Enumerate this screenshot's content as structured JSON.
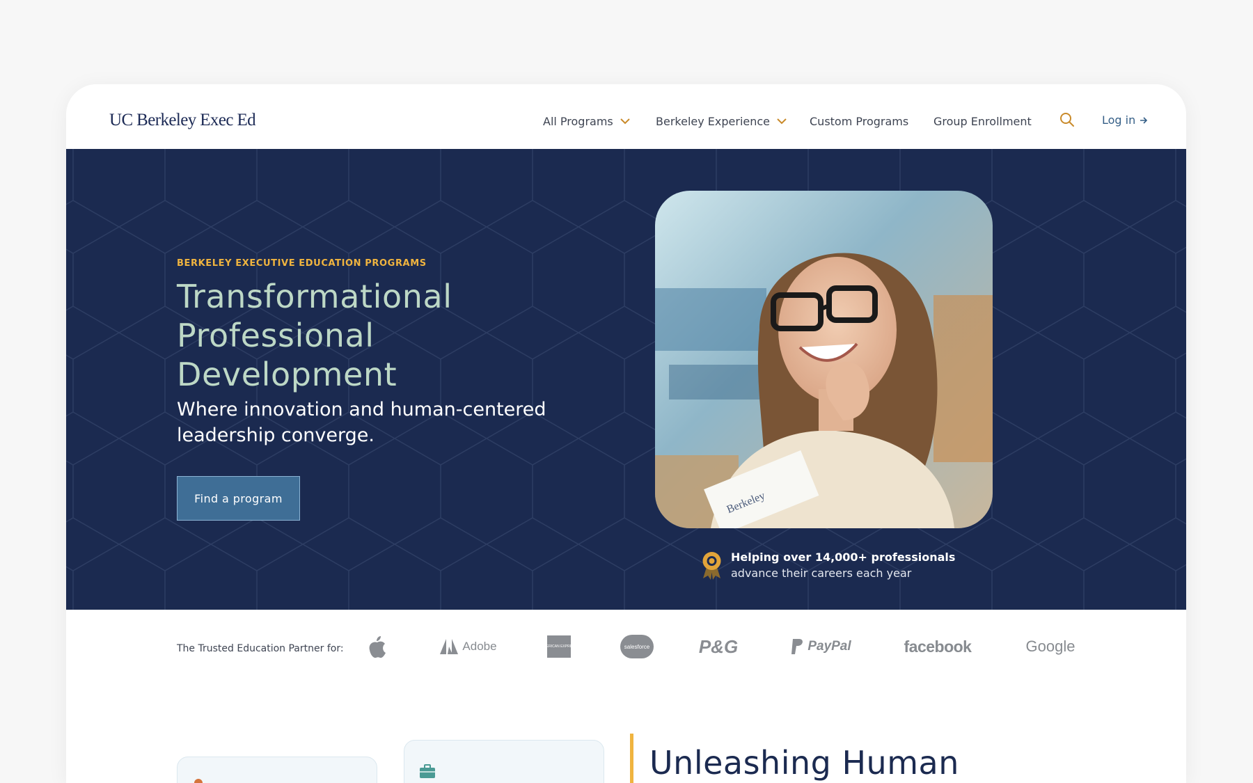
{
  "header": {
    "logo": "UC Berkeley Exec Ed",
    "nav": [
      {
        "label": "All Programs",
        "has_dropdown": true
      },
      {
        "label": "Berkeley Experience",
        "has_dropdown": true
      },
      {
        "label": "Custom Programs",
        "has_dropdown": false
      },
      {
        "label": "Group Enrollment",
        "has_dropdown": false
      }
    ],
    "search_icon": "search-icon",
    "login_label": "Log in",
    "login_icon": "arrow-right-icon"
  },
  "hero": {
    "eyebrow": "BERKELEY EXECUTIVE EDUCATION PROGRAMS",
    "title": "Transformational Professional Development",
    "subtitle": "Where innovation and human-centered leadership converge.",
    "cta_label": "Find a program",
    "stat_strong": "Helping over 14,000+ professionals",
    "stat_text": "advance their careers each year",
    "stat_icon": "award-medal-icon",
    "photo_card_text": "Berkeley"
  },
  "partners": {
    "label": "The Trusted Education Partner for:",
    "logos": [
      {
        "name": "apple-logo",
        "text": ""
      },
      {
        "name": "adobe-logo",
        "text": "Adobe"
      },
      {
        "name": "american-express-logo",
        "text": "AMERICAN EXPRESS"
      },
      {
        "name": "salesforce-logo",
        "text": "salesforce"
      },
      {
        "name": "pg-logo",
        "text": "P&G"
      },
      {
        "name": "paypal-logo",
        "text": "PayPal"
      },
      {
        "name": "facebook-logo",
        "text": "facebook"
      },
      {
        "name": "google-logo",
        "text": "Google"
      }
    ]
  },
  "section": {
    "title": "Unleashing Human",
    "card_icons": [
      "person-icon",
      "briefcase-icon"
    ]
  },
  "colors": {
    "navy": "#1b2a50",
    "gold": "#f0b43f",
    "hero_title": "#bdd8c6",
    "button": "#3f6e96",
    "link": "#345e86"
  }
}
